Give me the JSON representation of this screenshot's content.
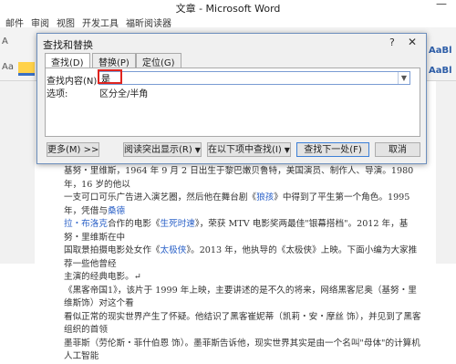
{
  "window": {
    "title": "文章 - Microsoft Word",
    "minimize": "—"
  },
  "ribbon_tabs": [
    "邮件",
    "审阅",
    "视图",
    "开发工具",
    "福昕阅读器"
  ],
  "ribbon_fragments": {
    "left_a": "A",
    "left_aa": "Aa",
    "right_aa1": "AaBl",
    "right_aa2": "AaBl"
  },
  "dialog": {
    "title": "查找和替换",
    "help": "?",
    "close": "✕",
    "tabs": [
      "查找(D)",
      "替换(P)",
      "定位(G)"
    ],
    "find_label": "查找内容(N):",
    "find_value": "是",
    "options_label": "选项:",
    "options_value": "区分全/半角",
    "buttons": {
      "more": "更多(M) >>",
      "reading_highlight": "阅读突出显示(R)",
      "find_in": "在以下项中查找(I)",
      "find_next": "查找下一处(F)",
      "cancel": "取消"
    }
  },
  "document": {
    "line1": "基努・里维斯，1964 年 9 月 2 日出生于黎巴嫩贝鲁特，美国演员、制作人、导演。1980 年，16 岁的他以",
    "line2_a": "一支可口可乐广告进入演艺圈，然后他在舞台剧《",
    "line2_link": "狼孩",
    "line2_b": "》中得到了平生第一个角色。1995 年，凭借与",
    "line2_link2": "桑德",
    "line3_link": "拉・布洛克",
    "line3_b": "合作的电影《",
    "line3_link2": "生死时速",
    "line3_c": "》，荣获 MTV 电影奖两最佳\"银幕搭档\"。2012 年，基努・里维斯在中",
    "line4_a": "国取景拍摄电影处女作《",
    "line4_link": "太极侠",
    "line4_b": "》。2013 年，他执导的《太极侠》上映。下面小编为大家推荐一些他曾经",
    "line5": "主演的经典电影。↵",
    "line6": "《黑客帝国1》，该片于 1999 年上映，主要讲述的是不久的将来，网络黑客尼奥（基努・里维斯饰）对这个看",
    "line7": "看似正常的现实世界产生了怀疑。他结识了黑客崔妮蒂（凯莉・安・摩丝 饰），并见到了黑客组织的首领",
    "line8": "墨菲斯（劳伦斯・菲什伯恩 饰）。墨菲斯告诉他，现实世界其实是由一个名叫\"母体\"的计算机人工智能"
  }
}
